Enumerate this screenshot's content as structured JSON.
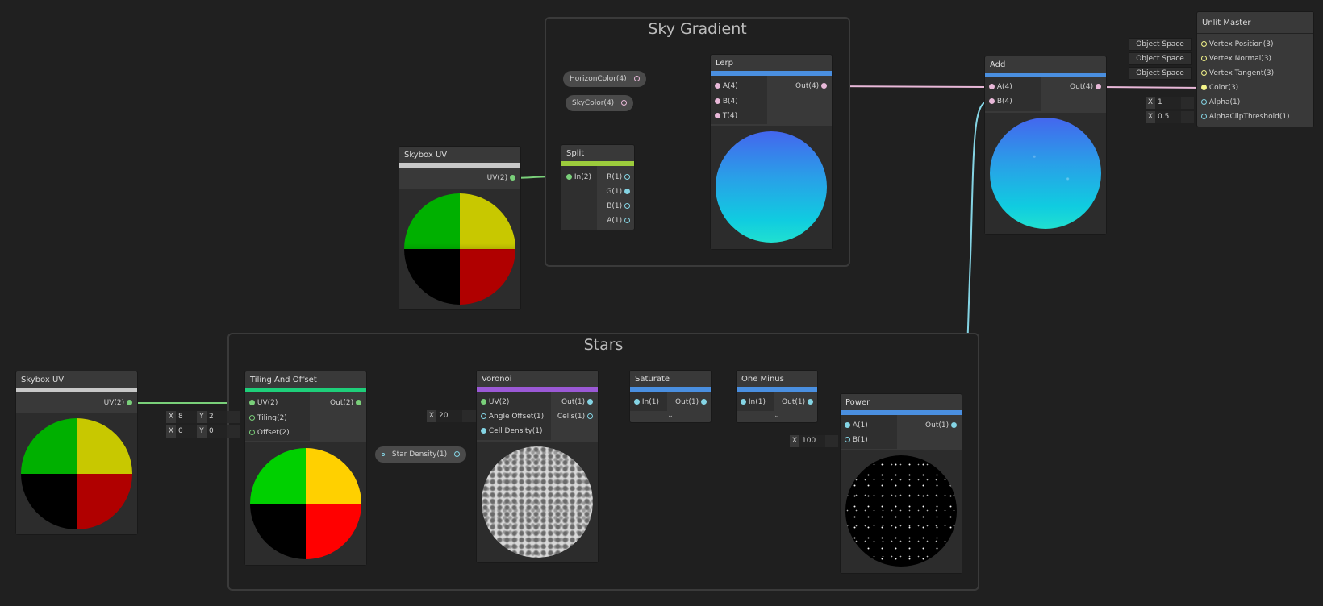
{
  "groups": {
    "sky_gradient": "Sky Gradient",
    "stars": "Stars"
  },
  "nodes": {
    "skybox_uv_top": {
      "title": "Skybox UV",
      "out": "UV(2)"
    },
    "skybox_uv_left": {
      "title": "Skybox UV",
      "out": "UV(2)"
    },
    "split": {
      "title": "Split",
      "in": "In(2)",
      "outs": [
        "R(1)",
        "G(1)",
        "B(1)",
        "A(1)"
      ]
    },
    "lerp": {
      "title": "Lerp",
      "ins": [
        "A(4)",
        "B(4)",
        "T(4)"
      ],
      "out": "Out(4)"
    },
    "add": {
      "title": "Add",
      "ins": [
        "A(4)",
        "B(4)"
      ],
      "out": "Out(4)"
    },
    "unlit_master": {
      "title": "Unlit Master",
      "ins": [
        "Vertex Position(3)",
        "Vertex Normal(3)",
        "Vertex Tangent(3)",
        "Color(3)",
        "Alpha(1)",
        "AlphaClipThreshold(1)"
      ],
      "spaces": [
        "Object Space",
        "Object Space",
        "Object Space"
      ],
      "alpha_value": "1",
      "clip_value": "0.5"
    },
    "tiling_offset": {
      "title": "Tiling And Offset",
      "ins": [
        "UV(2)",
        "Tiling(2)",
        "Offset(2)"
      ],
      "out": "Out(2)",
      "tiling_x": "8",
      "tiling_y": "2",
      "offset_x": "0",
      "offset_y": "0"
    },
    "voronoi": {
      "title": "Voronoi",
      "ins": [
        "UV(2)",
        "Angle Offset(1)",
        "Cell Density(1)"
      ],
      "outs": [
        "Out(1)",
        "Cells(1)"
      ],
      "angle_value": "20"
    },
    "saturate": {
      "title": "Saturate",
      "in": "In(1)",
      "out": "Out(1)"
    },
    "one_minus": {
      "title": "One Minus",
      "in": "In(1)",
      "out": "Out(1)"
    },
    "power": {
      "title": "Power",
      "ins": [
        "A(1)",
        "B(1)"
      ],
      "out": "Out(1)",
      "b_value": "100"
    }
  },
  "properties": {
    "horizon": "HorizonColor(4)",
    "sky": "SkyColor(4)",
    "star_density": "Star Density(1)"
  },
  "labels": {
    "x": "X",
    "y": "Y"
  },
  "icons": {
    "dropdown": "chevron-down-icon",
    "port": "port-dot-icon"
  },
  "colors": {
    "background": "#202020",
    "uv_accent": "#c8c8c8",
    "tiling_accent": "#1ecf7a",
    "split_accent": "#9ccc3c",
    "math_accent": "#4a8fe0",
    "voronoi_accent": "#9b59d6",
    "wire_uv": "#7ad07a",
    "wire_vector4": "#e8b8d8",
    "wire_float": "#84d4e4",
    "port_vector3": "#f4f48a"
  }
}
